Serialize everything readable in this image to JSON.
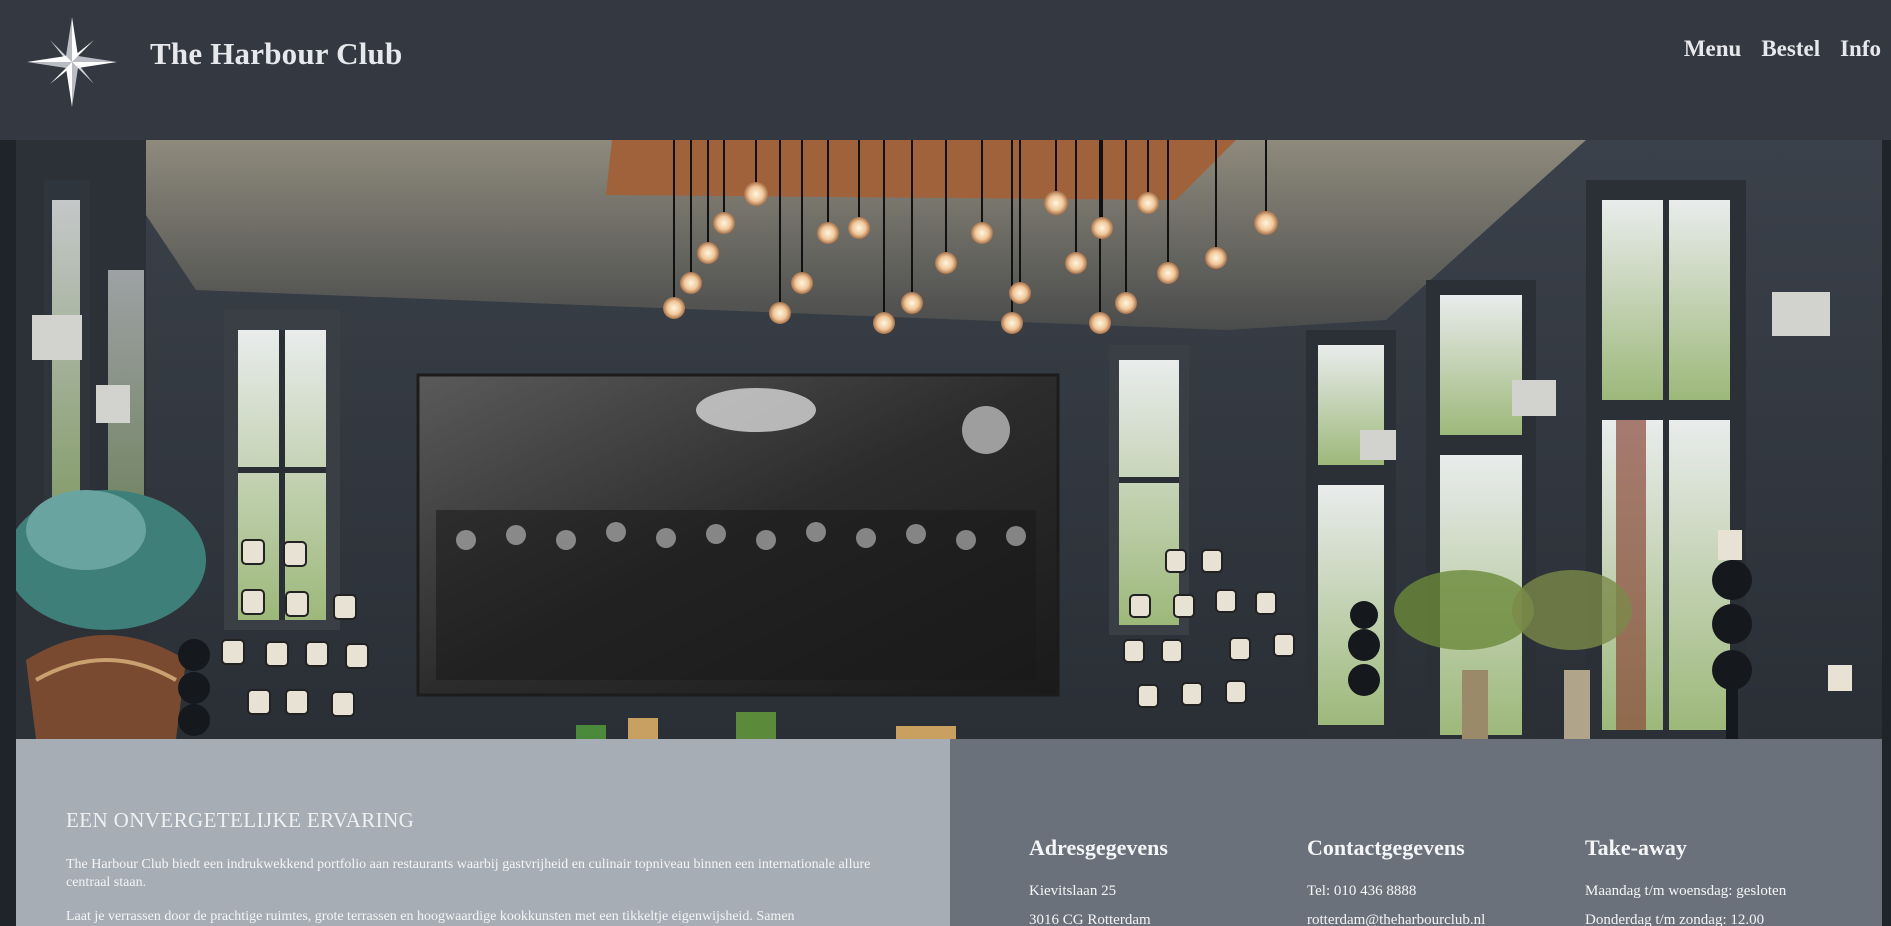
{
  "site": {
    "brand": "The Harbour Club",
    "logo_icon": "compass-rose-icon"
  },
  "nav": {
    "items": [
      {
        "label": "Menu"
      },
      {
        "label": "Bestel"
      },
      {
        "label": "Info"
      }
    ]
  },
  "hero": {
    "image_description": "restaurant-interior-photo"
  },
  "intro": {
    "title": "EEN ONVERGETELIJKE ERVARING",
    "paragraph_1": "The Harbour Club biedt een indrukwekkend portfolio aan restaurants waarbij gastvrijheid en culinair topniveau binnen een internationale allure centraal staan.",
    "paragraph_2": "Laat je verrassen door de prachtige ruimtes, grote terrassen en hoogwaardige kookkunsten met een tikkeltje eigenwijsheid. Samen"
  },
  "footer_info": {
    "address": {
      "heading": "Adresgegevens",
      "line_1": "Kievitslaan 25",
      "line_2": "3016 CG Rotterdam"
    },
    "contact": {
      "heading": "Contactgegevens",
      "line_1": "Tel: 010 436 8888",
      "line_2": "rotterdam@theharbourclub.nl"
    },
    "takeaway": {
      "heading": "Take-away",
      "line_1": "Maandag t/m woensdag: gesloten",
      "line_2": "Donderdag t/m zondag: 12.00"
    }
  },
  "colors": {
    "header_bg": "#343841",
    "panel_left_bg": "#a6adb5",
    "panel_right_bg": "#6b717a",
    "text_light": "#e6e8ec"
  }
}
